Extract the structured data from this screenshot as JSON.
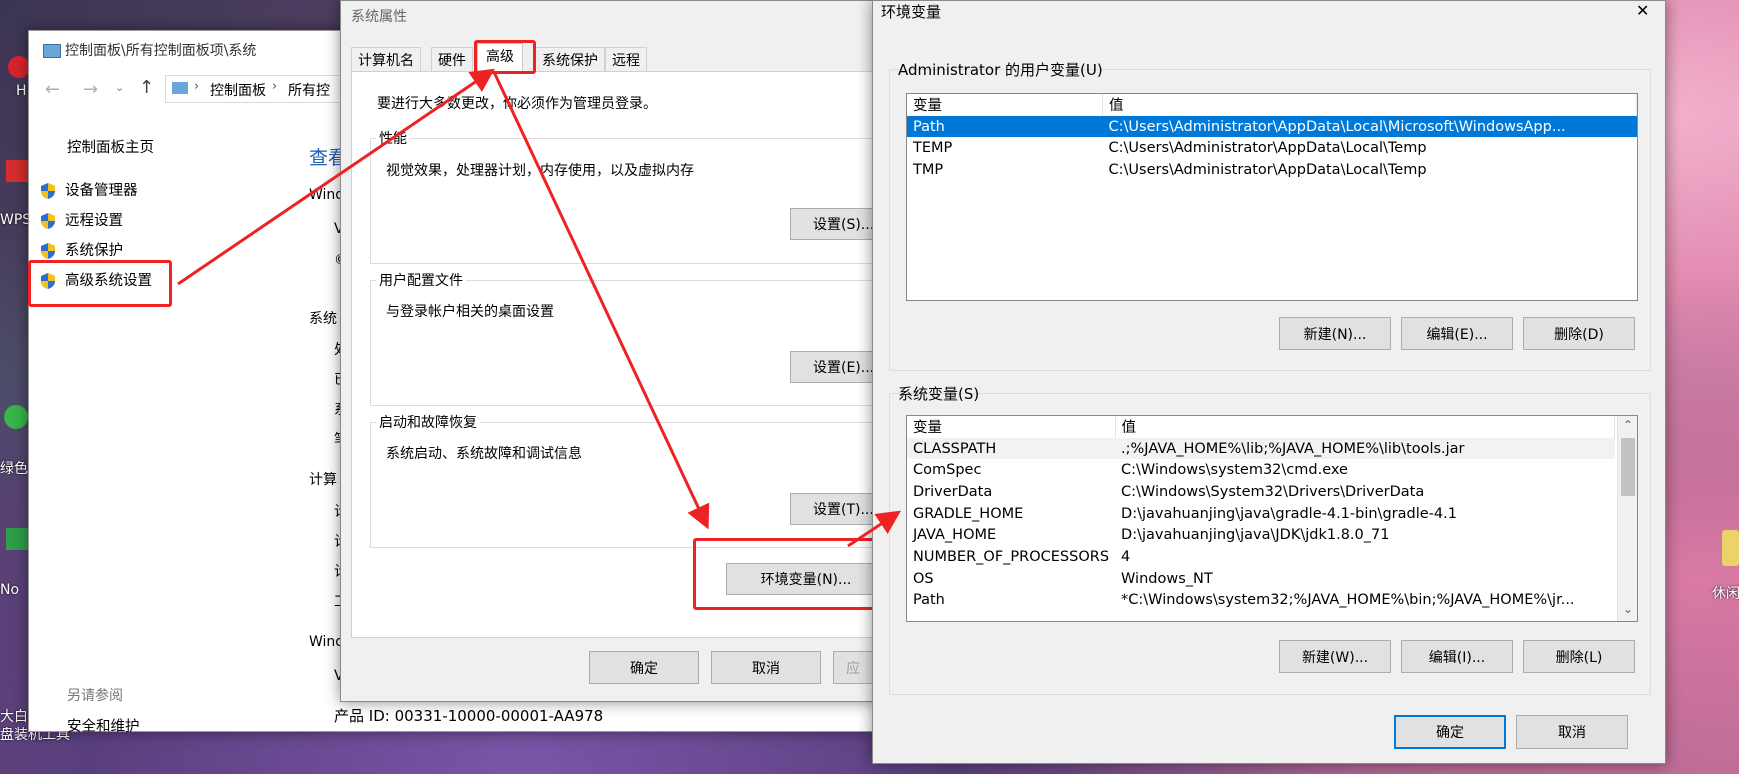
{
  "desktop": {
    "labels": [
      "H",
      "WPS",
      "绿色",
      "No",
      "大白菜",
      "盘装机工具",
      "休闲"
    ]
  },
  "control_panel": {
    "breadcrumb_title": "控制面板\\所有控制面板项\\系统",
    "address": [
      "控制面板",
      "所有控"
    ],
    "home": "控制面板主页",
    "links": [
      "设备管理器",
      "远程设置",
      "系统保护",
      "高级系统设置"
    ],
    "see_also": "另请参阅",
    "security": "安全和维护",
    "main_fragments": [
      "查看",
      "Wind",
      "V",
      "©",
      "系统",
      "处",
      "已",
      "系",
      "笔",
      "计算",
      "计",
      "计",
      "计",
      "工",
      "Wind",
      "V"
    ],
    "product_id": "产品 ID: 00331-10000-00001-AA978"
  },
  "sys_props": {
    "title": "系统属性",
    "tabs": [
      "计算机名",
      "硬件",
      "高级",
      "系统保护",
      "远程"
    ],
    "admin_notice": "要进行大多数更改，你必须作为管理员登录。",
    "perf_title": "性能",
    "perf_desc": "视觉效果，处理器计划，内存使用，以及虚拟内存",
    "profile_title": "用户配置文件",
    "profile_desc": "与登录帐户相关的桌面设置",
    "startup_title": "启动和故障恢复",
    "startup_desc": "系统启动、系统故障和调试信息",
    "settings_s": "设置(S)...",
    "settings_e": "设置(E)...",
    "settings_t": "设置(T)...",
    "env_button": "环境变量(N)...",
    "ok": "确定",
    "cancel": "取消",
    "apply": "应"
  },
  "env_vars": {
    "title": "环境变量",
    "user_group": "Administrator 的用户变量(U)",
    "col_var": "变量",
    "col_val": "值",
    "user_rows": [
      {
        "name": "Path",
        "value": "C:\\Users\\Administrator\\AppData\\Local\\Microsoft\\WindowsApp..."
      },
      {
        "name": "TEMP",
        "value": "C:\\Users\\Administrator\\AppData\\Local\\Temp"
      },
      {
        "name": "TMP",
        "value": "C:\\Users\\Administrator\\AppData\\Local\\Temp"
      }
    ],
    "user_new": "新建(N)...",
    "user_edit": "编辑(E)...",
    "user_delete": "删除(D)",
    "sys_group": "系统变量(S)",
    "sys_rows": [
      {
        "name": "CLASSPATH",
        "value": ".;%JAVA_HOME%\\lib;%JAVA_HOME%\\lib\\tools.jar"
      },
      {
        "name": "ComSpec",
        "value": "C:\\Windows\\system32\\cmd.exe"
      },
      {
        "name": "DriverData",
        "value": "C:\\Windows\\System32\\Drivers\\DriverData"
      },
      {
        "name": "GRADLE_HOME",
        "value": "D:\\javahuanjing\\java\\gradle-4.1-bin\\gradle-4.1"
      },
      {
        "name": "JAVA_HOME",
        "value": "D:\\javahuanjing\\java\\JDK\\jdk1.8.0_71"
      },
      {
        "name": "NUMBER_OF_PROCESSORS",
        "value": "4"
      },
      {
        "name": "OS",
        "value": "Windows_NT"
      },
      {
        "name": "Path",
        "value": "*C:\\Windows\\system32;%JAVA_HOME%\\bin;%JAVA_HOME%\\jr..."
      }
    ],
    "sys_new": "新建(W)...",
    "sys_edit": "编辑(I)...",
    "sys_delete": "删除(L)",
    "ok": "确定",
    "cancel": "取消",
    "close_glyph": "✕",
    "scroll_up": "⌃",
    "scroll_down": "⌄"
  },
  "colors": {
    "accent": "#0078d7",
    "highlight": "#ee2222"
  }
}
